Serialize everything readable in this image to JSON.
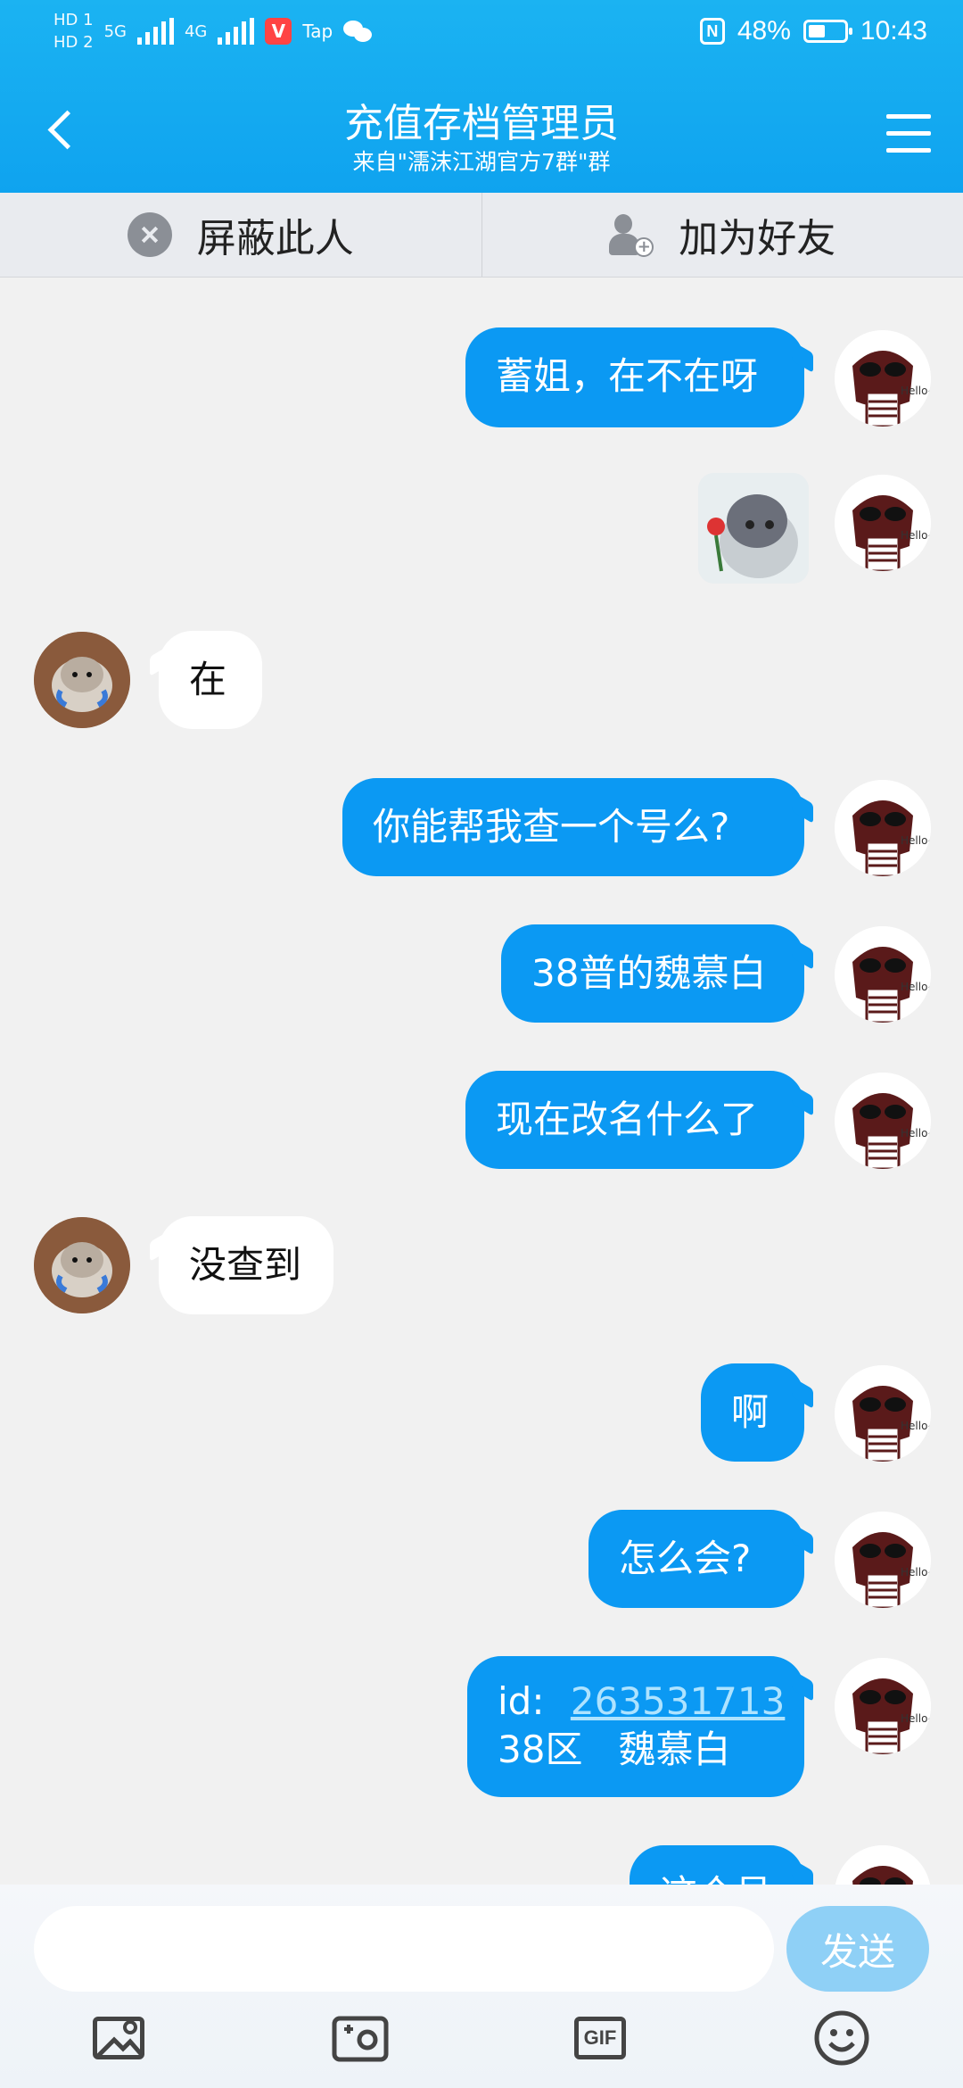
{
  "status_bar": {
    "sim1": "HD 1",
    "sim2": "HD 2",
    "net1": "5G",
    "net2": "4G",
    "tap_label": "Tap",
    "battery_percent": "48%",
    "battery_level": 0.48,
    "time": "10:43",
    "nfc_label": "N"
  },
  "header": {
    "title": "充值存档管理员",
    "subtitle": "来自\"濡沫江湖官方7群\"群"
  },
  "actions": {
    "block_label": "屏蔽此人",
    "add_friend_label": "加为好友"
  },
  "messages": [
    {
      "side": "me",
      "text": "蓄姐，在不在呀"
    },
    {
      "side": "me",
      "type": "sticker"
    },
    {
      "side": "other",
      "text": "在"
    },
    {
      "side": "me",
      "text": "你能帮我查一个号么?"
    },
    {
      "side": "me",
      "text": "38普的魏慕白"
    },
    {
      "side": "me",
      "text": "现在改名什么了"
    },
    {
      "side": "other",
      "text": "没查到"
    },
    {
      "side": "me",
      "text": "啊"
    },
    {
      "side": "me",
      "text": "怎么会?"
    },
    {
      "side": "me",
      "text_prefix": "id:",
      "link": "263531713",
      "text_line2": "38区   魏慕白"
    },
    {
      "side": "me",
      "text": "这个号",
      "partial": true
    }
  ],
  "input": {
    "placeholder": "",
    "send_label": "发送",
    "gif_label": "GIF"
  },
  "colors": {
    "header": "#12a8f0",
    "my_bubble": "#0b99f3",
    "other_bubble": "#ffffff",
    "send_button": "#8fd0f6",
    "background": "#f1f1f1"
  }
}
